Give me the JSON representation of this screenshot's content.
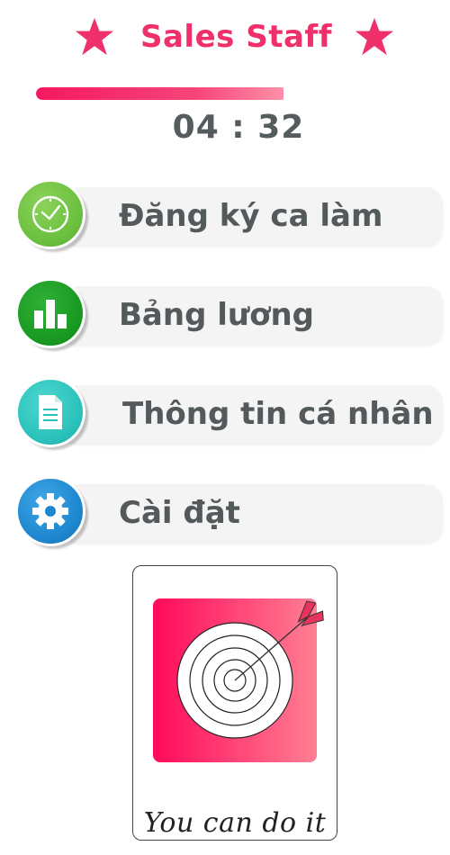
{
  "header": {
    "title": "Sales Staff",
    "left_icon": "star-icon",
    "right_icon": "star-icon",
    "accent_color": "#f0306a"
  },
  "timer": {
    "progress": 0.78,
    "value": "04 : 32"
  },
  "menu": {
    "items": [
      {
        "label": "Đăng ký ca làm",
        "icon": "clock-icon",
        "color": "#6cc040"
      },
      {
        "label": "Bảng lương",
        "icon": "bar-chart-icon",
        "color": "#1a9a22"
      },
      {
        "label": "Thông tin cá nhân",
        "icon": "document-icon",
        "color": "#2cc2bc"
      },
      {
        "label": "Cài đặt",
        "icon": "gear-icon",
        "color": "#1f87cf"
      }
    ]
  },
  "card": {
    "image_icon": "target-dart-icon",
    "caption": "You can do it"
  }
}
